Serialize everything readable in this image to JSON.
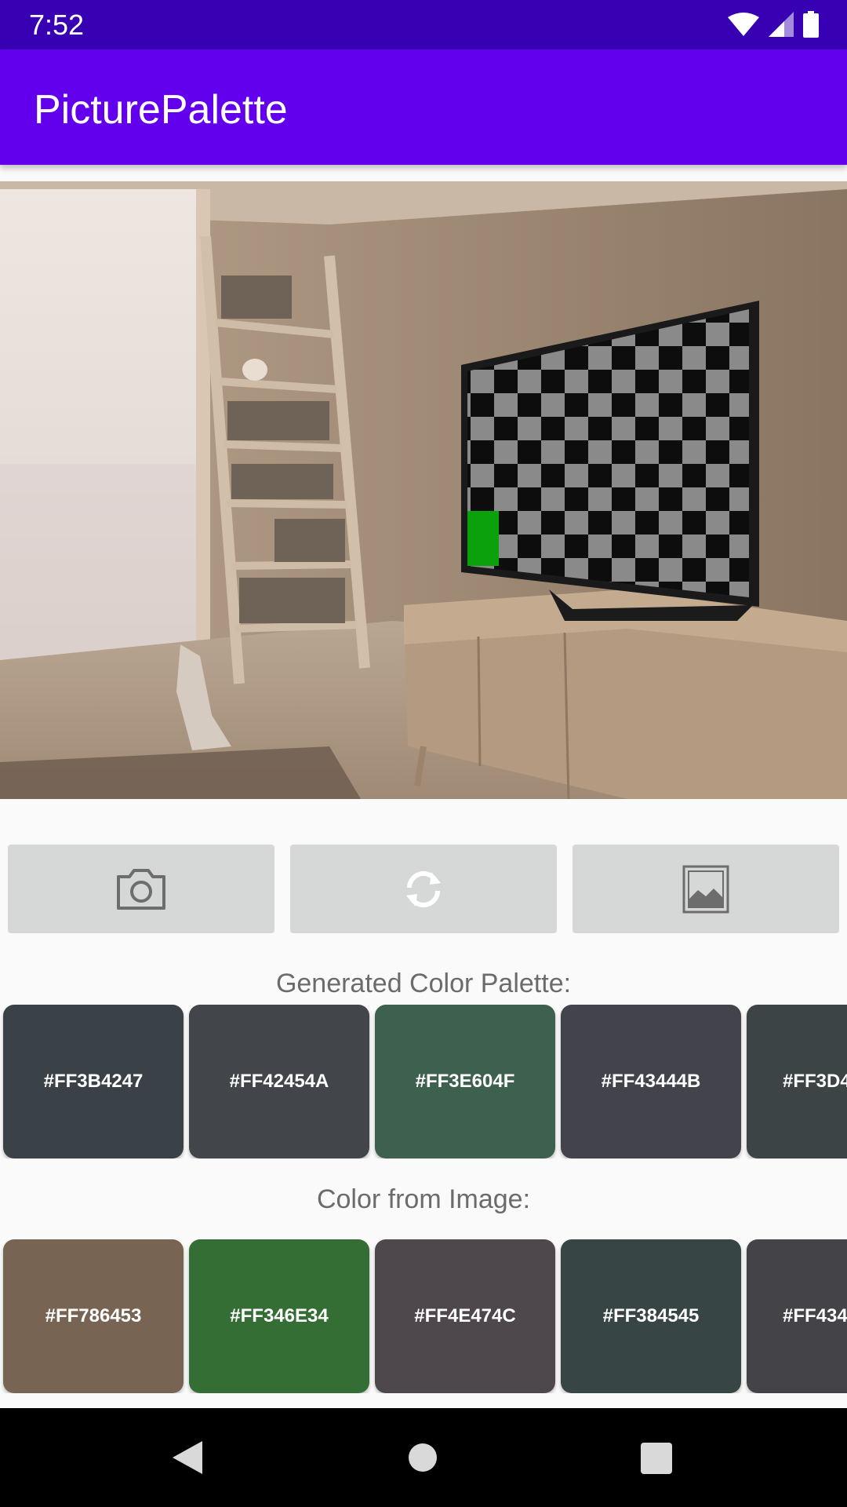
{
  "status_bar": {
    "time": "7:52",
    "icons": [
      "wifi-icon",
      "signal-icon",
      "battery-icon"
    ]
  },
  "app_bar": {
    "title": "PicturePalette"
  },
  "image": {
    "description": "photo",
    "highlight_color": "#0aa10a"
  },
  "buttons": [
    {
      "name": "camera-button",
      "icon": "camera-icon"
    },
    {
      "name": "refresh-button",
      "icon": "refresh-icon"
    },
    {
      "name": "gallery-button",
      "icon": "image-icon"
    }
  ],
  "generated_palette": {
    "label": "Generated Color Palette:",
    "swatches": [
      {
        "label": "#FF3B4247",
        "color": "#3b4247"
      },
      {
        "label": "#FF42454A",
        "color": "#42454a"
      },
      {
        "label": "#FF3E604F",
        "color": "#3e604f"
      },
      {
        "label": "#FF43444B",
        "color": "#43444b"
      },
      {
        "label": "#FF3D4",
        "color": "#3d4446"
      }
    ]
  },
  "image_palette": {
    "label": "Color from Image:",
    "swatches": [
      {
        "label": "#FF786453",
        "color": "#786453"
      },
      {
        "label": "#FF346E34",
        "color": "#346e34"
      },
      {
        "label": "#FF4E474C",
        "color": "#4e474c"
      },
      {
        "label": "#FF384545",
        "color": "#384545"
      },
      {
        "label": "#FF434",
        "color": "#434348"
      }
    ]
  },
  "nav_bar": {
    "icons": [
      "back-icon",
      "home-icon",
      "recents-icon"
    ]
  }
}
